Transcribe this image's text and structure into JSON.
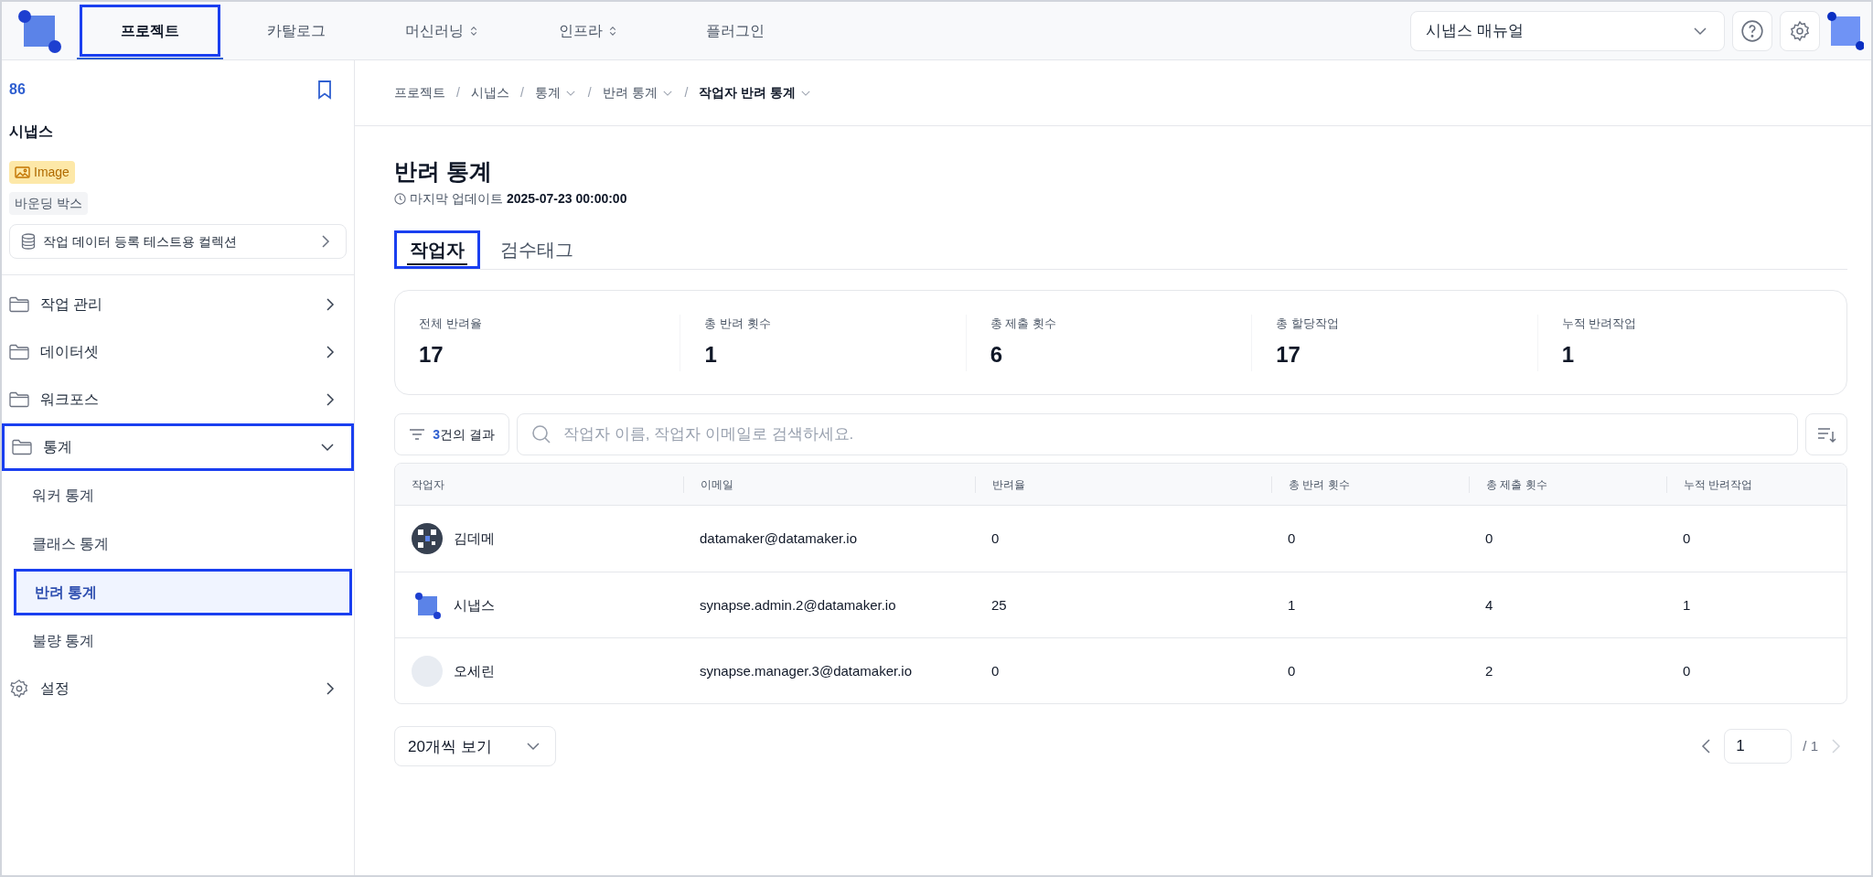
{
  "top_nav": {
    "items": [
      {
        "label": "프로젝트",
        "selected": true,
        "highlighted": true,
        "has_menu": false
      },
      {
        "label": "카탈로그",
        "selected": false,
        "highlighted": false,
        "has_menu": false
      },
      {
        "label": "머신러닝",
        "selected": false,
        "highlighted": false,
        "has_menu": true
      },
      {
        "label": "인프라",
        "selected": false,
        "highlighted": false,
        "has_menu": true
      },
      {
        "label": "플러그인",
        "selected": false,
        "highlighted": false,
        "has_menu": false
      }
    ],
    "manual_select": {
      "value": "시냅스 매뉴얼"
    }
  },
  "sidebar": {
    "project_id": "86",
    "project_name": "시냅스",
    "badges": [
      {
        "label": "Image",
        "kind": "image"
      },
      {
        "label": "바운딩 박스",
        "kind": "plain"
      }
    ],
    "collection": "작업 데이터 등록 테스트용 컬렉션",
    "items": [
      {
        "label": "작업 관리",
        "kind": "folder",
        "expanded": false,
        "highlighted": false
      },
      {
        "label": "데이터셋",
        "kind": "folder",
        "expanded": false,
        "highlighted": false
      },
      {
        "label": "워크포스",
        "kind": "folder",
        "expanded": false,
        "highlighted": false
      },
      {
        "label": "통계",
        "kind": "folder",
        "expanded": true,
        "highlighted": true,
        "children": [
          {
            "label": "워커 통계",
            "selected": false,
            "highlighted": false
          },
          {
            "label": "클래스 통계",
            "selected": false,
            "highlighted": false
          },
          {
            "label": "반려 통계",
            "selected": true,
            "highlighted": true
          },
          {
            "label": "불량 통계",
            "selected": false,
            "highlighted": false
          }
        ]
      },
      {
        "label": "설정",
        "kind": "gear",
        "expanded": false,
        "highlighted": false
      }
    ]
  },
  "breadcrumb": [
    {
      "label": "프로젝트",
      "dropdown": false,
      "current": false
    },
    {
      "separator": "/",
      "label": "시냅스",
      "dropdown": false,
      "current": false
    },
    {
      "separator": "/",
      "label": "통계",
      "dropdown": true,
      "current": false
    },
    {
      "separator": "/",
      "label": "반려 통계",
      "dropdown": true,
      "current": false
    },
    {
      "separator": "/",
      "label": "작업자 반려 통계",
      "dropdown": true,
      "current": true
    }
  ],
  "page": {
    "title": "반려 통계",
    "updated_label": "마지막 업데이트",
    "updated_value": "2025-07-23 00:00:00"
  },
  "tabs": [
    {
      "label": "작업자",
      "selected": true,
      "highlighted": true
    },
    {
      "label": "검수태그",
      "selected": false,
      "highlighted": false
    }
  ],
  "stats": [
    {
      "label": "전체 반려율",
      "value": "17"
    },
    {
      "label": "총 반려 횟수",
      "value": "1"
    },
    {
      "label": "총 제출 횟수",
      "value": "6"
    },
    {
      "label": "총 할당작업",
      "value": "17"
    },
    {
      "label": "누적 반려작업",
      "value": "1"
    }
  ],
  "filter": {
    "result_count": "3",
    "result_text": "건의 결과",
    "search_placeholder": "작업자 이름, 작업자 이메일로 검색하세요."
  },
  "table": {
    "columns": [
      "작업자",
      "이메일",
      "반려율",
      "총 반려 횟수",
      "총 제출 횟수",
      "누적 반려작업"
    ],
    "rows": [
      {
        "kind": "pattern",
        "cells": [
          "김데메",
          "datamaker@datamaker.io",
          "0",
          "0",
          "0",
          "0"
        ]
      },
      {
        "kind": "logo",
        "cells": [
          "시냅스",
          "synapse.admin.2@datamaker.io",
          "25",
          "1",
          "4",
          "1"
        ]
      },
      {
        "kind": "blank",
        "cells": [
          "오세린",
          "synapse.manager.3@datamaker.io",
          "0",
          "0",
          "2",
          "0"
        ]
      }
    ]
  },
  "pagination": {
    "page_size": "20개씩 보기",
    "page": "1",
    "total": "/ 1"
  }
}
